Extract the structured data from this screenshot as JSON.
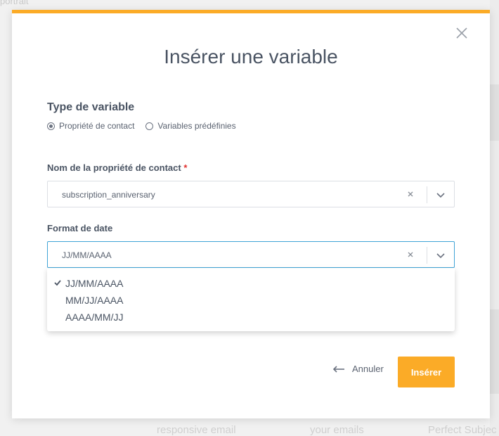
{
  "background": {
    "top_text": "portrait",
    "bottom_texts": [
      "responsive email",
      "your emails",
      "Perfect Subjec"
    ]
  },
  "modal": {
    "title": "Insérer une variable",
    "icons": {
      "close": "close-icon"
    },
    "variable_type": {
      "label": "Type de variable",
      "options": [
        {
          "label": "Propriété de contact",
          "checked": true
        },
        {
          "label": "Variables prédéfinies",
          "checked": false
        }
      ]
    },
    "contact_property": {
      "label": "Nom de la propriété de contact",
      "required_mark": "*",
      "value": "subscription_anniversary"
    },
    "date_format": {
      "label": "Format de date",
      "value": "JJ/MM/AAAA",
      "options": [
        {
          "label": "JJ/MM/AAAA",
          "selected": true
        },
        {
          "label": "MM/JJ/AAAA",
          "selected": false
        },
        {
          "label": "AAAA/MM/JJ",
          "selected": false
        }
      ]
    },
    "buttons": {
      "cancel": "Annuler",
      "insert": "Insérer"
    },
    "colors": {
      "accent": "#fbab27",
      "focus_border": "#3fa3d6",
      "required": "#e0312f",
      "text": "#4a5463"
    }
  }
}
